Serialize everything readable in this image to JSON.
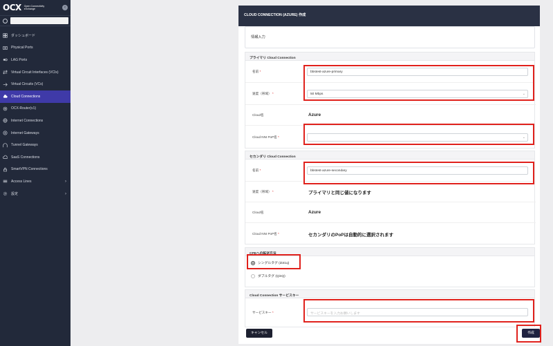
{
  "app": {
    "logo": "OCX",
    "brand_line1": "Open Connectivity",
    "brand_line2": "eXchange",
    "collapse_icon": "‹"
  },
  "sidebar": {
    "items": [
      {
        "label": "ダッシュボード",
        "icon": "dashboard-icon"
      },
      {
        "label": "Physical Ports",
        "icon": "port-icon"
      },
      {
        "label": "LAG Ports",
        "icon": "lag-icon"
      },
      {
        "label": "Virtual Circuit Interfaces (VCIs)",
        "icon": "vci-icon"
      },
      {
        "label": "Virtual Circuits (VCs)",
        "icon": "vc-icon"
      },
      {
        "label": "Cloud Connections",
        "icon": "cloud-icon"
      },
      {
        "label": "OCX-Router(v1)",
        "icon": "router-icon"
      },
      {
        "label": "Internet Connections",
        "icon": "globe-icon"
      },
      {
        "label": "Internet Gateways",
        "icon": "gateway-icon"
      },
      {
        "label": "Tunnel Gateways",
        "icon": "tunnel-icon"
      },
      {
        "label": "SaaS Connections",
        "icon": "saas-icon"
      },
      {
        "label": "SmartVPN Connections",
        "icon": "vpn-icon"
      },
      {
        "label": "Access Lines",
        "icon": "access-icon"
      },
      {
        "label": "設定",
        "icon": "gear-icon"
      }
    ],
    "active": "Cloud Connections"
  },
  "page": {
    "title": "CLOUD CONNECTION (AZURE) 作成",
    "tab_label": "情報入力"
  },
  "primary": {
    "title": "プライマリ Cloud Connection",
    "name_label": "名前",
    "name_value": "bbstest-azure-primary",
    "speed_label": "速度（帯域）",
    "speed_value": "50 Mbps",
    "cloud_label": "Cloud名",
    "cloud_value": "Azure",
    "pop_label": "Cloud NNI PoP名",
    "pop_value": ""
  },
  "secondary": {
    "title": "セカンダリ Cloud Connection",
    "name_label": "名前",
    "name_value": "bbstest-azure-secondary",
    "speed_label": "速度（帯域）",
    "speed_value": "プライマリと同じ値になります",
    "cloud_label": "Cloud名",
    "cloud_value": "Azure",
    "pop_label": "Cloud NNI PoP名",
    "pop_value": "セカンダリのPoPは自動的に選択されます"
  },
  "cpe": {
    "title": "CPEへの転送方法",
    "option_single": "シングルタグ (dot1q)",
    "option_double": "ダブルタグ (QinQ)",
    "selected": "single"
  },
  "service_key": {
    "title": "Cloud Connection サービスキー",
    "label": "サービスキー",
    "placeholder": "サービスキーを入力お願いします"
  },
  "actions": {
    "cancel": "キャンセル",
    "create": "作成"
  },
  "required_mark": "*",
  "colors": {
    "sidebar_bg": "#22293a",
    "active": "#3f3aa8",
    "highlight": "#e0201b"
  }
}
